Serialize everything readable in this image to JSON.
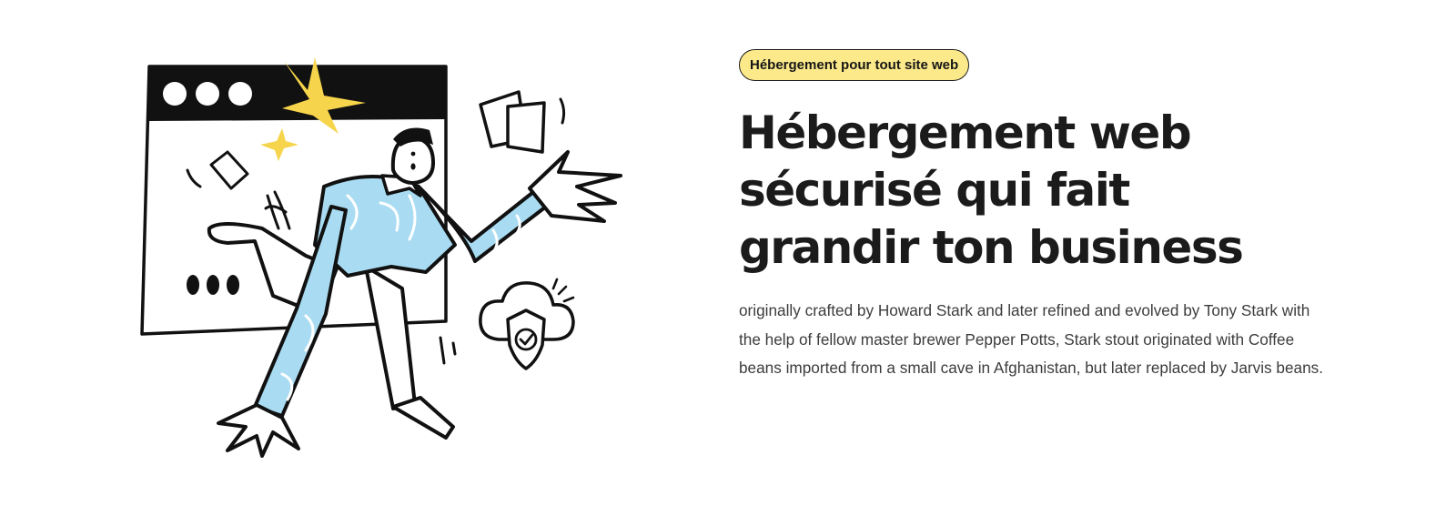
{
  "badge": {
    "label": "Hébergement pour tout site web"
  },
  "hero": {
    "title": "Hébergement web sécurisé qui fait grandir ton business",
    "description": "originally crafted by Howard Stark and later refined and evolved by Tony Stark with the help of fellow master brewer Pepper Potts, Stark stout originated with Coffee beans imported from a small cave in Afghanistan, but later replaced by Jarvis beans."
  },
  "illustration": {
    "icons": [
      "browser-window-icon",
      "star-burst-icon",
      "paper-sheet-icon",
      "cloud-shield-check-icon"
    ],
    "colors": {
      "ink": "#111111",
      "shirt": "#a9dcf2",
      "star": "#f6d44b",
      "badge_bg": "#fbe98a"
    }
  }
}
